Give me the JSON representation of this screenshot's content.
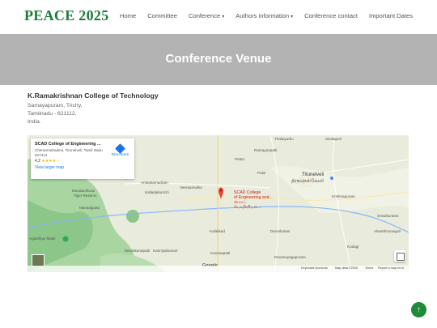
{
  "brand": "PEACE 2025",
  "nav": {
    "items": [
      {
        "label": "Home",
        "dropdown": false
      },
      {
        "label": "Committee",
        "dropdown": false
      },
      {
        "label": "Conference",
        "dropdown": true
      },
      {
        "label": "Authors information",
        "dropdown": true
      },
      {
        "label": "Conference contact",
        "dropdown": false
      },
      {
        "label": "Important Dates",
        "dropdown": false
      }
    ]
  },
  "hero": {
    "title": "Conference Venue"
  },
  "venue": {
    "name": "K.Ramakrishnan College of Technology",
    "address_lines": [
      "Samayapuram, Trichy,",
      "Tamilnadu - 621112,",
      "India."
    ]
  },
  "map": {
    "card": {
      "title": "SCAD College of Engineering ...",
      "address": "Cheranmahadevi, Tirunelveli, Tamil Nadu 627414",
      "rating": "4.2",
      "stars": "★★★★☆",
      "view_larger": "View larger map",
      "directions": "Directions"
    },
    "pin_label": [
      "SCAD College",
      "of Engineering and...",
      "ஸ்காட்",
      "பொறியியல்..."
    ],
    "places": [
      {
        "text": "Tirunelveli",
        "cls": "city"
      },
      {
        "text": "திருநெல்வேலி",
        "cls": "city"
      },
      {
        "text": "Mundanthurai",
        "cls": "small"
      },
      {
        "text": "Tiger Reserve",
        "cls": "small"
      },
      {
        "text": "Ambasamudram",
        "cls": "small"
      },
      {
        "text": "Kalladaikurichi",
        "cls": "small"
      },
      {
        "text": "Veeravanallur",
        "cls": "small"
      },
      {
        "text": "Thalaiyuthu",
        "cls": "small"
      },
      {
        "text": "Ramayanpatti",
        "cls": "small"
      },
      {
        "text": "Sivalaperi",
        "cls": "small"
      },
      {
        "text": "Palai",
        "cls": "small"
      },
      {
        "text": "Krishnapuram",
        "cls": "small"
      },
      {
        "text": "Srivaikuntam",
        "cls": "small"
      },
      {
        "text": "Alwarthirunagari",
        "cls": "small"
      },
      {
        "text": "Kanniyakumari",
        "cls": "small"
      },
      {
        "text": "Devarkulam",
        "cls": "small"
      },
      {
        "text": "Kalakkad",
        "cls": "small"
      },
      {
        "text": "Moolakaraipatti",
        "cls": "small"
      },
      {
        "text": "Agasthiya Malai",
        "cls": "small"
      },
      {
        "text": "Kanasapatti",
        "cls": "small"
      },
      {
        "text": "Munanjipatti",
        "cls": "small"
      },
      {
        "text": "Devanayagapuram",
        "cls": "small"
      },
      {
        "text": "Pettai",
        "cls": "small"
      },
      {
        "text": "Kodagi",
        "cls": "small"
      }
    ],
    "footer": {
      "shortcuts": "Keyboard shortcuts",
      "mapdata": "Map data ©2025",
      "terms": "Terms",
      "report": "Report a map error",
      "google": "Google"
    }
  },
  "colors": {
    "brand_green": "#1e7b3a",
    "hero_gray": "#b3b3b3",
    "pin_red": "#ea4335",
    "map_green": "#a9d6a1",
    "river_blue": "#8ab4f8"
  },
  "icons": {
    "scroll_top": "arrow-up-icon",
    "directions": "directions-icon",
    "pin": "map-pin-icon",
    "fullscreen": "fullscreen-icon"
  }
}
